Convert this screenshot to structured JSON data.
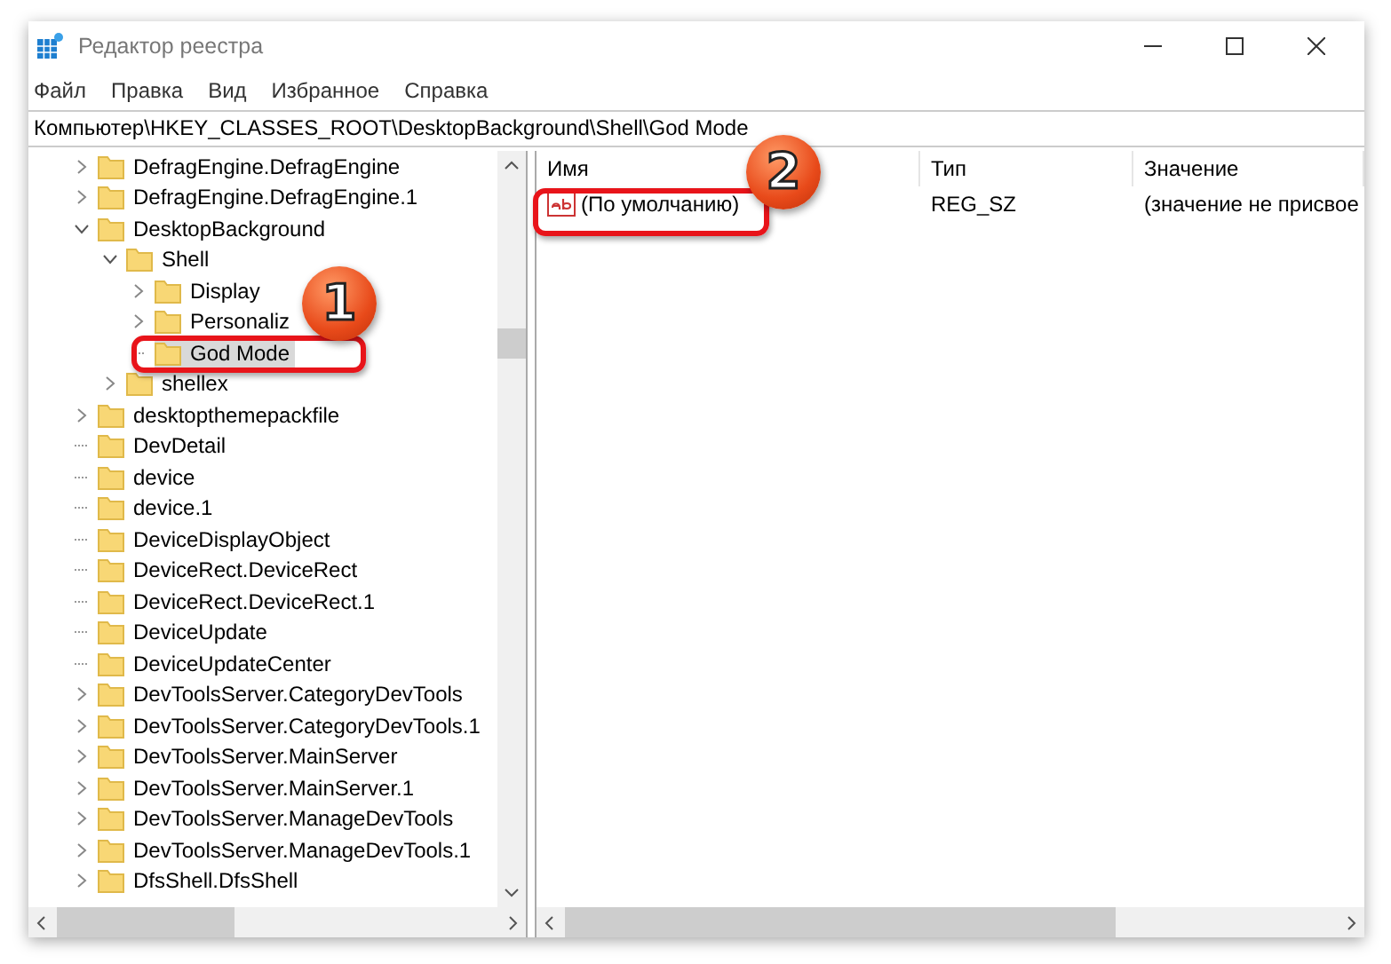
{
  "window": {
    "title": "Редактор реестра"
  },
  "menu": [
    "Файл",
    "Правка",
    "Вид",
    "Избранное",
    "Справка"
  ],
  "address": "Компьютер\\HKEY_CLASSES_ROOT\\DesktopBackground\\Shell\\God Mode",
  "tree": [
    {
      "label": "DefragEngine.DefragEngine",
      "kind": "collapsed",
      "selected": false
    },
    {
      "label": "DefragEngine.DefragEngine.1",
      "kind": "collapsed",
      "selected": false
    },
    {
      "label": "DesktopBackground",
      "kind": "expanded",
      "selected": false,
      "children": [
        {
          "label": "Shell",
          "kind": "expanded",
          "selected": false,
          "children": [
            {
              "label": "Display",
              "kind": "collapsed",
              "selected": false
            },
            {
              "label": "Personaliz",
              "kind": "collapsed",
              "selected": false
            },
            {
              "label": "God Mode",
              "kind": "leaf",
              "selected": true
            }
          ]
        },
        {
          "label": "shellex",
          "kind": "collapsed",
          "selected": false
        }
      ]
    },
    {
      "label": "desktopthemepackfile",
      "kind": "collapsed",
      "selected": false
    },
    {
      "label": "DevDetail",
      "kind": "leaf",
      "selected": false
    },
    {
      "label": "device",
      "kind": "leaf",
      "selected": false
    },
    {
      "label": "device.1",
      "kind": "leaf",
      "selected": false
    },
    {
      "label": "DeviceDisplayObject",
      "kind": "leaf",
      "selected": false
    },
    {
      "label": "DeviceRect.DeviceRect",
      "kind": "leaf",
      "selected": false
    },
    {
      "label": "DeviceRect.DeviceRect.1",
      "kind": "leaf",
      "selected": false
    },
    {
      "label": "DeviceUpdate",
      "kind": "leaf",
      "selected": false
    },
    {
      "label": "DeviceUpdateCenter",
      "kind": "leaf",
      "selected": false
    },
    {
      "label": "DevToolsServer.CategoryDevTools",
      "kind": "collapsed",
      "selected": false
    },
    {
      "label": "DevToolsServer.CategoryDevTools.1",
      "kind": "collapsed",
      "selected": false
    },
    {
      "label": "DevToolsServer.MainServer",
      "kind": "collapsed",
      "selected": false
    },
    {
      "label": "DevToolsServer.MainServer.1",
      "kind": "collapsed",
      "selected": false
    },
    {
      "label": "DevToolsServer.ManageDevTools",
      "kind": "collapsed",
      "selected": false
    },
    {
      "label": "DevToolsServer.ManageDevTools.1",
      "kind": "collapsed",
      "selected": false
    },
    {
      "label": "DfsShell.DfsShell",
      "kind": "collapsed",
      "selected": false
    }
  ],
  "values_table": {
    "columns": [
      "Имя",
      "Тип",
      "Значение"
    ],
    "rows": [
      {
        "name": "(По умолчанию)",
        "type": "REG_SZ",
        "value": "(значение не присвое"
      }
    ]
  },
  "callouts": [
    {
      "number": "1"
    },
    {
      "number": "2"
    }
  ]
}
